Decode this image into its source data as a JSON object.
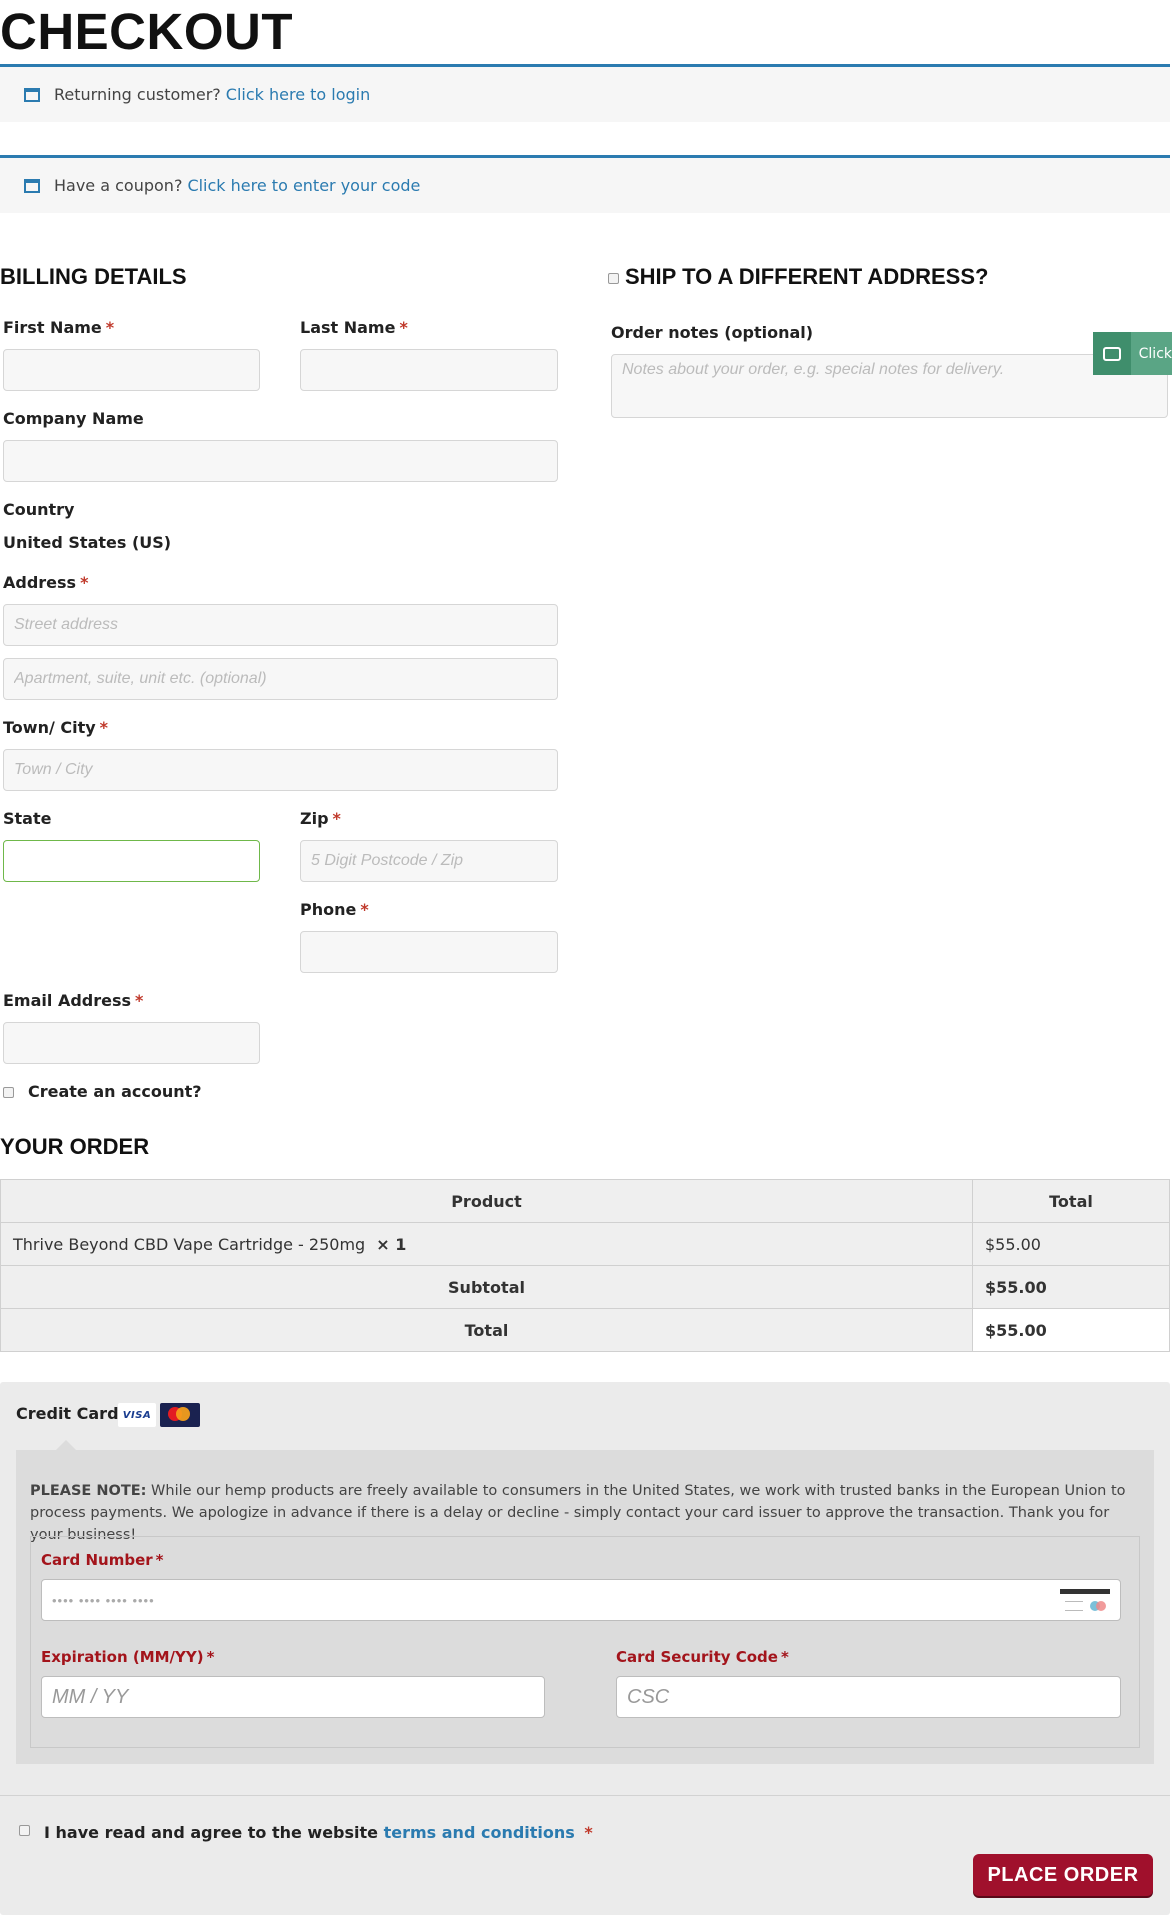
{
  "page_title": "CHECKOUT",
  "notices": {
    "login_text": "Returning customer?",
    "login_link": "Click here to login",
    "coupon_text": "Have a coupon?",
    "coupon_link": "Click here to enter your code"
  },
  "billing": {
    "heading": "BILLING DETAILS",
    "first_name_label": "First Name",
    "last_name_label": "Last Name",
    "company_label": "Company Name",
    "country_label": "Country",
    "country_value": "United States (US)",
    "address_label": "Address",
    "address_placeholder": "Street address",
    "address2_placeholder": "Apartment, suite, unit etc. (optional)",
    "city_label": "Town/ City",
    "city_placeholder": "Town / City",
    "state_label": "State",
    "zip_label": "Zip",
    "zip_placeholder": "5 Digit Postcode / Zip",
    "phone_label": "Phone",
    "email_label": "Email Address",
    "create_account_label": "Create an account?",
    "required_mark": "*"
  },
  "shipping": {
    "heading": "SHIP TO A DIFFERENT ADDRESS?",
    "order_notes_label": "Order notes (optional)",
    "order_notes_placeholder": "Notes about your order, e.g. special notes for delivery."
  },
  "chat_widget": {
    "label": "Click"
  },
  "order": {
    "heading": "YOUR ORDER",
    "col_product": "Product",
    "col_total": "Total",
    "item_name": "Thrive Beyond CBD Vape Cartridge - 250mg",
    "item_qty": "× 1",
    "item_total": "$55.00",
    "subtotal_label": "Subtotal",
    "subtotal_value": "$55.00",
    "total_label": "Total",
    "total_value": "$55.00"
  },
  "payment": {
    "method_label": "Credit Card",
    "visa_text": "VISA",
    "note_bold": "PLEASE NOTE:",
    "note_text": " While our hemp products are freely available to consumers in the United States, we work with trusted banks in the European Union to process payments. We apologize in advance if there is a delay or decline - simply contact your card issuer to approve the transaction. Thank you for your business!",
    "card_number_label": "Card Number",
    "card_number_placeholder": "•••• •••• •••• ••••",
    "expiry_label": "Expiration (MM/YY)",
    "expiry_placeholder": "MM / YY",
    "csc_label": "Card Security Code",
    "csc_placeholder": "CSC"
  },
  "terms": {
    "text": "I have read and agree to the website",
    "link": "terms and conditions",
    "required_mark": "*"
  },
  "place_order_label": "PLACE ORDER"
}
